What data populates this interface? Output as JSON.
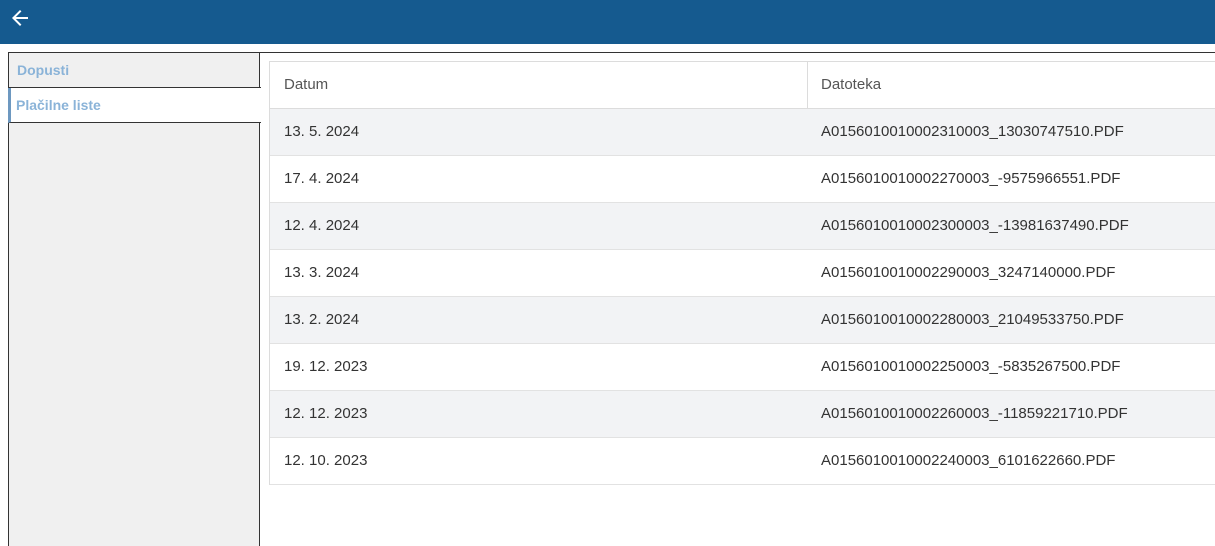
{
  "topbar": {
    "back_icon": "arrow-left-icon",
    "color": "#155a8f"
  },
  "sidebar": {
    "items": [
      {
        "label": "Dopusti",
        "active": false
      },
      {
        "label": "Plačilne liste",
        "active": true
      }
    ]
  },
  "table": {
    "columns": [
      "Datum",
      "Datoteka"
    ],
    "rows": [
      {
        "date": "13. 5. 2024",
        "file": "A0156010010002310003_13030747510.PDF"
      },
      {
        "date": "17. 4. 2024",
        "file": "A0156010010002270003_-9575966551.PDF"
      },
      {
        "date": "12. 4. 2024",
        "file": "A0156010010002300003_-13981637490.PDF"
      },
      {
        "date": "13. 3. 2024",
        "file": "A0156010010002290003_3247140000.PDF"
      },
      {
        "date": "13. 2. 2024",
        "file": "A0156010010002280003_21049533750.PDF"
      },
      {
        "date": "19. 12. 2023",
        "file": "A0156010010002250003_-5835267500.PDF"
      },
      {
        "date": "12. 12. 2023",
        "file": "A0156010010002260003_-11859221710.PDF"
      },
      {
        "date": "12. 10. 2023",
        "file": "A0156010010002240003_6101622660.PDF"
      }
    ]
  }
}
